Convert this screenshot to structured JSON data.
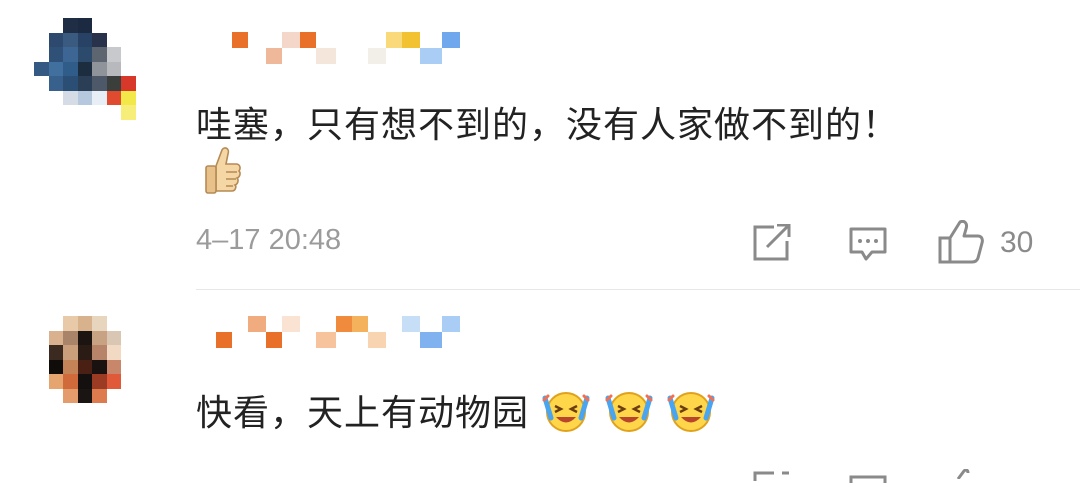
{
  "comments": [
    {
      "text": "哇塞，只有想不到的，没有人家做不到的！",
      "emoji": "thumbs-up-icon",
      "timestamp": "4–17 20:48",
      "like_count": "30",
      "avatar_colors": [
        "#ffffff",
        "#ffffff",
        "#1f2e45",
        "#1b2a40",
        "#ffffff",
        "#ffffff",
        "#ffffff",
        "#ffffff",
        "#ffffff",
        "#2d4a6e",
        "#3a5a80",
        "#274264",
        "#28324a",
        "#ffffff",
        "#ffffff",
        "#ffffff",
        "#ffffff",
        "#2f5178",
        "#3e6694",
        "#2c4a6c",
        "#5c6570",
        "#c7c9cc",
        "#ffffff",
        "#ffffff",
        "#345a84",
        "#41709e",
        "#2f5c88",
        "#1d2d40",
        "#8f949a",
        "#b7b9bc",
        "#ffffff",
        "#ffffff",
        "#ffffff",
        "#37608d",
        "#2b4e74",
        "#2a3f55",
        "#4d5968",
        "#3a3f3c",
        "#d8382a",
        "#ffffff",
        "#ffffff",
        "#ffffff",
        "#d5dce6",
        "#b6c8dd",
        "#e8eef6",
        "#e04a2e",
        "#f2e84a",
        "#ffffff",
        "#ffffff",
        "#ffffff",
        "#ffffff",
        "#ffffff",
        "#ffffff",
        "#ffffff",
        "#f7ee7a",
        "#ffffff",
        "#ffffff",
        "#ffffff",
        "#ffffff",
        "#ffffff",
        "#ffffff",
        "#ffffff",
        "#ffffff",
        "#ffffff"
      ],
      "name_colors": [
        "#ffffff",
        "#e87028",
        "#ffffff",
        "#f0b89a",
        "#f4d7c8",
        "#e87028",
        "#f5e6dc",
        "#ffffff",
        "#ffffff",
        "#f2eee8",
        "#f9d97a",
        "#f2c233",
        "#a9cdf5",
        "#6fa8ec"
      ]
    },
    {
      "text": "快看，天上有动物园",
      "emoji": "laughing-tears-icon",
      "avatar_colors": [
        "#ffffff",
        "#ffffff",
        "#e8c9a8",
        "#d8b28d",
        "#e7d5be",
        "#ffffff",
        "#ffffff",
        "#ffffff",
        "#ffffff",
        "#d9b18e",
        "#a98468",
        "#1c1410",
        "#c7a383",
        "#d9c7b3",
        "#ffffff",
        "#ffffff",
        "#ffffff",
        "#3a2a20",
        "#c9a07b",
        "#2a1c14",
        "#b7846a",
        "#f2d9c4",
        "#ffffff",
        "#ffffff",
        "#ffffff",
        "#0f0c0a",
        "#c48457",
        "#4a1f14",
        "#1a1210",
        "#c8866a",
        "#ffffff",
        "#ffffff",
        "#ffffff",
        "#e6a46f",
        "#d06a3a",
        "#141010",
        "#9b3b24",
        "#e05a3a",
        "#ffffff",
        "#ffffff",
        "#ffffff",
        "#ffffff",
        "#e59c6c",
        "#1a1412",
        "#dd7a4e",
        "#ffffff",
        "#ffffff",
        "#ffffff",
        "#ffffff",
        "#ffffff",
        "#ffffff",
        "#ffffff",
        "#ffffff",
        "#ffffff",
        "#ffffff",
        "#ffffff",
        "#ffffff",
        "#ffffff",
        "#ffffff",
        "#ffffff",
        "#ffffff",
        "#ffffff",
        "#ffffff",
        "#ffffff"
      ],
      "name_colors": [
        "#e87028",
        "#ffffff",
        "#f0ab7e",
        "#e87028",
        "#fbe3d4",
        "#ffffff",
        "#f6c39c",
        "#f08a3c",
        "#f5b25c",
        "#f9d4b0",
        "#ffffff",
        "#c7def7",
        "#7fb2ee",
        "#a9cdf5"
      ]
    }
  ],
  "colors": {
    "text": "#222222",
    "meta": "#9b9b9b",
    "icon": "#8a8a8a",
    "divider": "#e7e7e7"
  }
}
